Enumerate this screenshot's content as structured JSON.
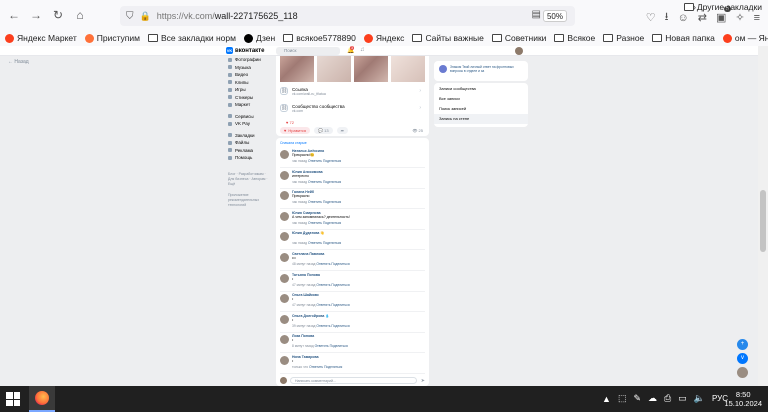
{
  "browser": {
    "url_host": "https://vk.com/",
    "url_path": "wall-227175625_118",
    "zoom": "50%",
    "ext_badge": "5"
  },
  "bookmarks": [
    {
      "label": "Яндекс Маркет",
      "color": "#fc3f1d",
      "icon": "yandex-market-icon"
    },
    {
      "label": "Приступим",
      "color": "#ff7139",
      "icon": "firefox-icon"
    },
    {
      "label": "Все закладки норм",
      "color": "",
      "icon": "folder-icon"
    },
    {
      "label": "Дзен",
      "color": "#000000",
      "icon": "dzen-icon"
    },
    {
      "label": "всякое5778890",
      "color": "",
      "icon": "folder-icon"
    },
    {
      "label": "Яндекс",
      "color": "#fc3f1d",
      "icon": "yandex-icon"
    },
    {
      "label": "Сайты важные",
      "color": "",
      "icon": "folder-icon"
    },
    {
      "label": "Советники",
      "color": "",
      "icon": "folder-icon"
    },
    {
      "label": "Всякое",
      "color": "",
      "icon": "folder-icon"
    },
    {
      "label": "Разное",
      "color": "",
      "icon": "folder-icon"
    },
    {
      "label": "Новая папка",
      "color": "",
      "icon": "folder-icon"
    },
    {
      "label": "ом — Яндекс: нашло...",
      "color": "#fc3f1d",
      "icon": "yandex-icon"
    }
  ],
  "bookmarks_more": "»",
  "bookmarks_other": "Другие закладки",
  "vk": {
    "logo": "вконтакте",
    "search_placeholder": "Поиск",
    "notif_count": "3",
    "back_label": "← Назад",
    "menu": [
      "Фотографии",
      "Музыка",
      "Видео",
      "Клипы",
      "Игры",
      "Стикеры",
      "Маркет"
    ],
    "menu2": [
      "Сервисы",
      "VK Pay"
    ],
    "menu3": [
      "Закладки",
      "Файлы",
      "Реклама",
      "Помощь"
    ],
    "footer": "Блог · Разработчикам · Для бизнеса · Авторам · Ещё",
    "footer2": "Приложение рекомендательных технологий",
    "post": {
      "link1_title": "Ссылка",
      "link1_sub": "vk.com/wall-ru_tfiatua",
      "link2_title": "Сообщество сообщества",
      "link2_sub": "vk.com",
      "like_count": "72",
      "like_label": "Нравится",
      "comment_count": "13",
      "views": "25"
    },
    "comments_header": "Сначала старые",
    "comments": [
      {
        "name": "Наталья Алёксина",
        "text": "Прекрасно!😊",
        "meta": "час назад",
        "reply": "Ответить",
        "share": "Поделиться"
      },
      {
        "name": "Юлия Анисимова",
        "text": "интересно",
        "meta": "час назад",
        "reply": "Ответить",
        "share": "Поделиться"
      },
      {
        "name": "Галина Нейб",
        "text": "Прекрасно",
        "meta": "час назад",
        "reply": "Ответить",
        "share": "Поделиться"
      },
      {
        "name": "Юлия Смирнова",
        "text": "А чем запомнилась? деятельность!",
        "meta": "час назад",
        "reply": "Ответить",
        "share": "Поделиться"
      },
      {
        "name": "Юлия Дудатова 👋",
        "text": "",
        "meta": "час назад",
        "reply": "Ответить",
        "share": "Поделиться"
      },
      {
        "name": "Светлана Павлова",
        "text": "•••",
        "meta": "48 минут назад",
        "reply": "Ответить",
        "share": "Поделиться"
      },
      {
        "name": "Татьяна Попова",
        "text": "•",
        "meta": "47 минут назад",
        "reply": "Ответить",
        "share": "Поделиться"
      },
      {
        "name": "Ольга Шайковс",
        "text": "•",
        "meta": "47 минут назад",
        "reply": "Ответить",
        "share": "Поделиться"
      },
      {
        "name": "Ольга Долгойрова 💧",
        "text": "•",
        "meta": "39 минут назад",
        "reply": "Ответить",
        "share": "Поделиться"
      },
      {
        "name": "Лиза Попова",
        "text": "•",
        "meta": "8 минут назад",
        "reply": "Ответить",
        "share": "Поделиться"
      },
      {
        "name": "Нина Тамарова",
        "text": "•",
        "meta": "только что",
        "reply": "Ответить",
        "share": "Поделиться"
      }
    ],
    "comment_placeholder": "Написать комментарий...",
    "right_card": "Знаком Твой личный ответ на фронтовых вопросы в отделе и за",
    "right_menu": [
      "Записи сообщества",
      "Все записи",
      "Поиск записей",
      "Запись на стене"
    ]
  },
  "taskbar": {
    "lang": "РУС",
    "time": "8:50",
    "date": "15.10.2024"
  }
}
